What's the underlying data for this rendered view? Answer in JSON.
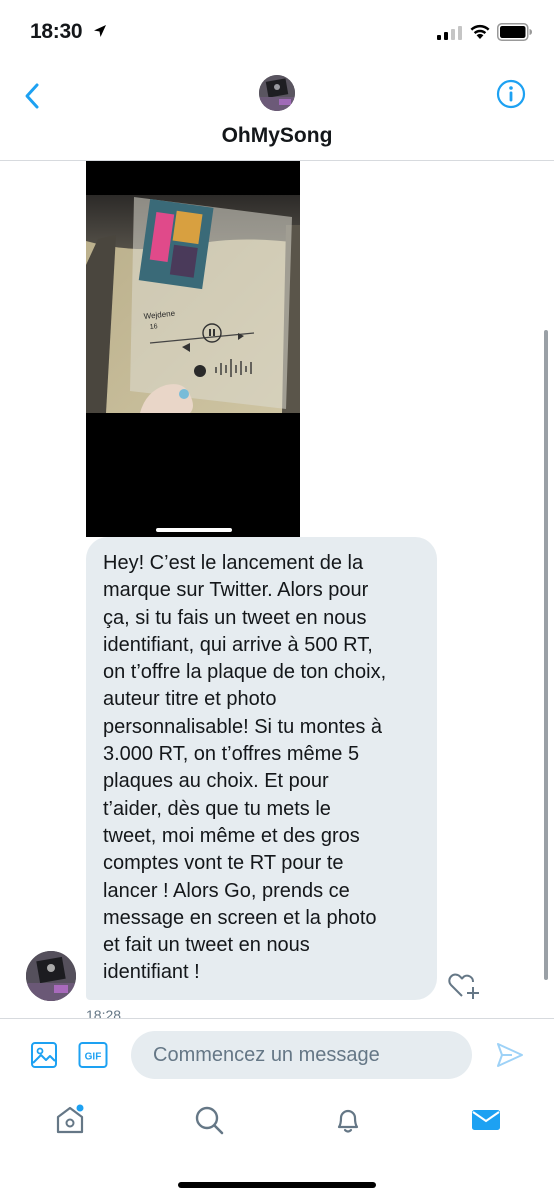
{
  "status_bar": {
    "time": "18:30"
  },
  "header": {
    "title": "OhMySong"
  },
  "message": {
    "text": "Hey! C’est le lancement de la\nmarque sur Twitter. Alors pour\nça, si tu fais un tweet en nous\nidentifiant, qui arrive à 500 RT,\non t’offre la plaque de ton choix,\nauteur titre et photo\npersonnalisable! Si tu montes à\n3.000 RT, on t’offres même 5\nplaques au choix. Et pour\nt’aider, dès que tu mets le\ntweet, moi même et des gros\ncomptes vont te RT pour te\nlancer ! Alors Go, prends ce\nmessage en screen et la photo\net fait un tweet en nous\nidentifiant !",
    "timestamp": "18:28"
  },
  "media": {
    "plaque_artist": "Wejdene",
    "plaque_track": "16"
  },
  "composer": {
    "placeholder": "Commencez un message"
  },
  "colors": {
    "accent": "#1da1f2",
    "bubble": "#e6ecf0",
    "muted": "#657786"
  }
}
